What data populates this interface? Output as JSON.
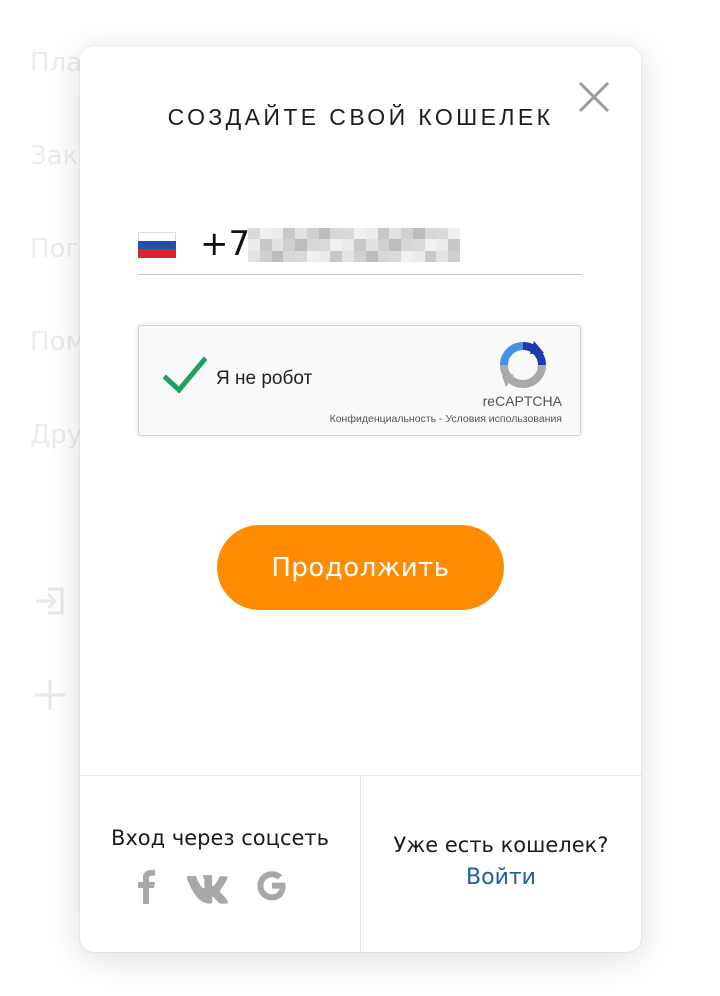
{
  "background_menu": {
    "items": [
      "Пла",
      "Зак",
      "Пог",
      "Пом",
      "Дру"
    ]
  },
  "modal": {
    "title": "СОЗДАЙТЕ СВОЙ КОШЕЛЕК",
    "close_icon": "close-icon",
    "phone": {
      "country_flag": "russia-flag-icon",
      "value": "+7"
    },
    "recaptcha": {
      "label": "Я не робот",
      "brand": "reCAPTCHA",
      "privacy_link": "Конфиденциальность",
      "separator": " - ",
      "terms_link": "Условия использования",
      "checked": true
    },
    "continue_label": "Продолжить",
    "footer": {
      "social_title": "Вход через соцсеть",
      "social_icons": [
        "facebook-icon",
        "vk-icon",
        "google-icon"
      ],
      "wallet_question": "Уже есть кошелек?",
      "login_link": "Войти"
    }
  },
  "colors": {
    "accent": "#ff8c00",
    "link": "#1e5fa4",
    "check": "#1aa260",
    "flag_white": "#ffffff",
    "flag_blue": "#2152a6",
    "flag_red": "#d5262d"
  }
}
